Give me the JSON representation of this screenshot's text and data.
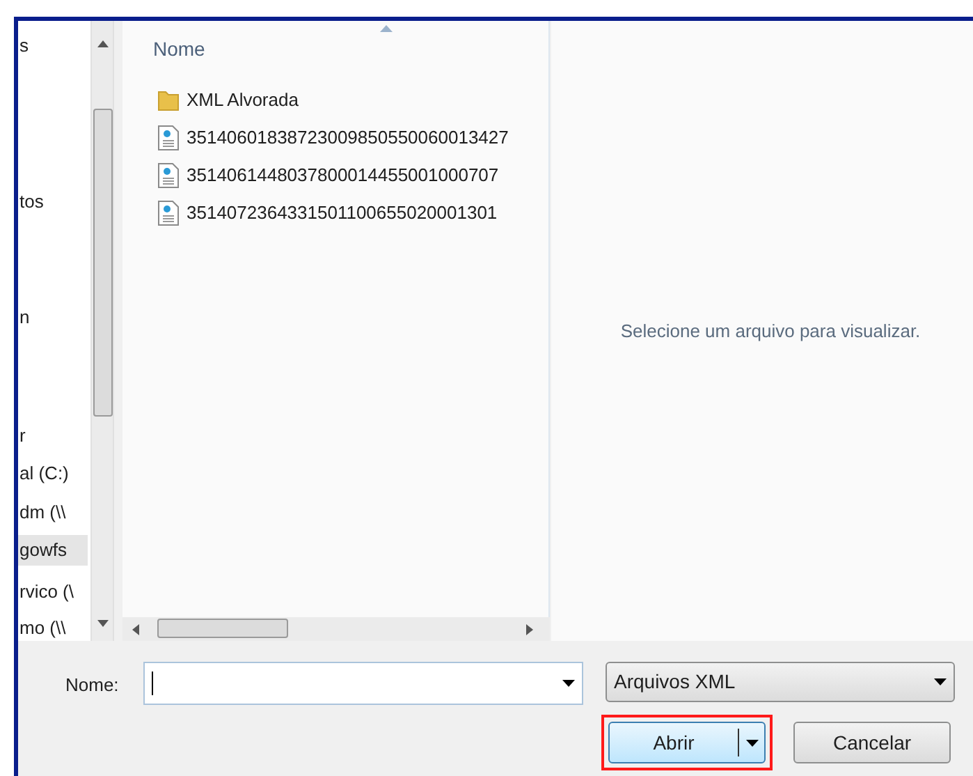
{
  "nav_pane": {
    "items": [
      {
        "label": "s",
        "selected": false
      },
      {
        "label": "tos",
        "selected": false
      },
      {
        "label": "n",
        "selected": false
      },
      {
        "label": "r",
        "selected": false
      },
      {
        "label": "al (C:)",
        "selected": false
      },
      {
        "label": "dm (\\\\",
        "selected": false
      },
      {
        "label": "gowfs",
        "selected": true
      },
      {
        "label": "rvico (\\",
        "selected": false
      },
      {
        "label": "mo (\\\\",
        "selected": false
      }
    ]
  },
  "file_list": {
    "column_header": "Nome",
    "files": [
      {
        "kind": "folder",
        "name": "XML Alvorada"
      },
      {
        "kind": "xml",
        "name": "35140601838723009850550060013427"
      },
      {
        "kind": "xml",
        "name": "3514061448037800014455001000707"
      },
      {
        "kind": "xml",
        "name": "3514072364331501100655020001301"
      }
    ]
  },
  "preview": {
    "message": "Selecione um arquivo para visualizar."
  },
  "filename": {
    "label": "Nome:"
  },
  "file_type": {
    "value": "Arquivos XML"
  },
  "buttons": [
    {
      "label": "Abrir",
      "kind": "split",
      "highlighted": true
    },
    {
      "label": "Cancelar",
      "kind": "plain",
      "highlighted": false
    }
  ]
}
